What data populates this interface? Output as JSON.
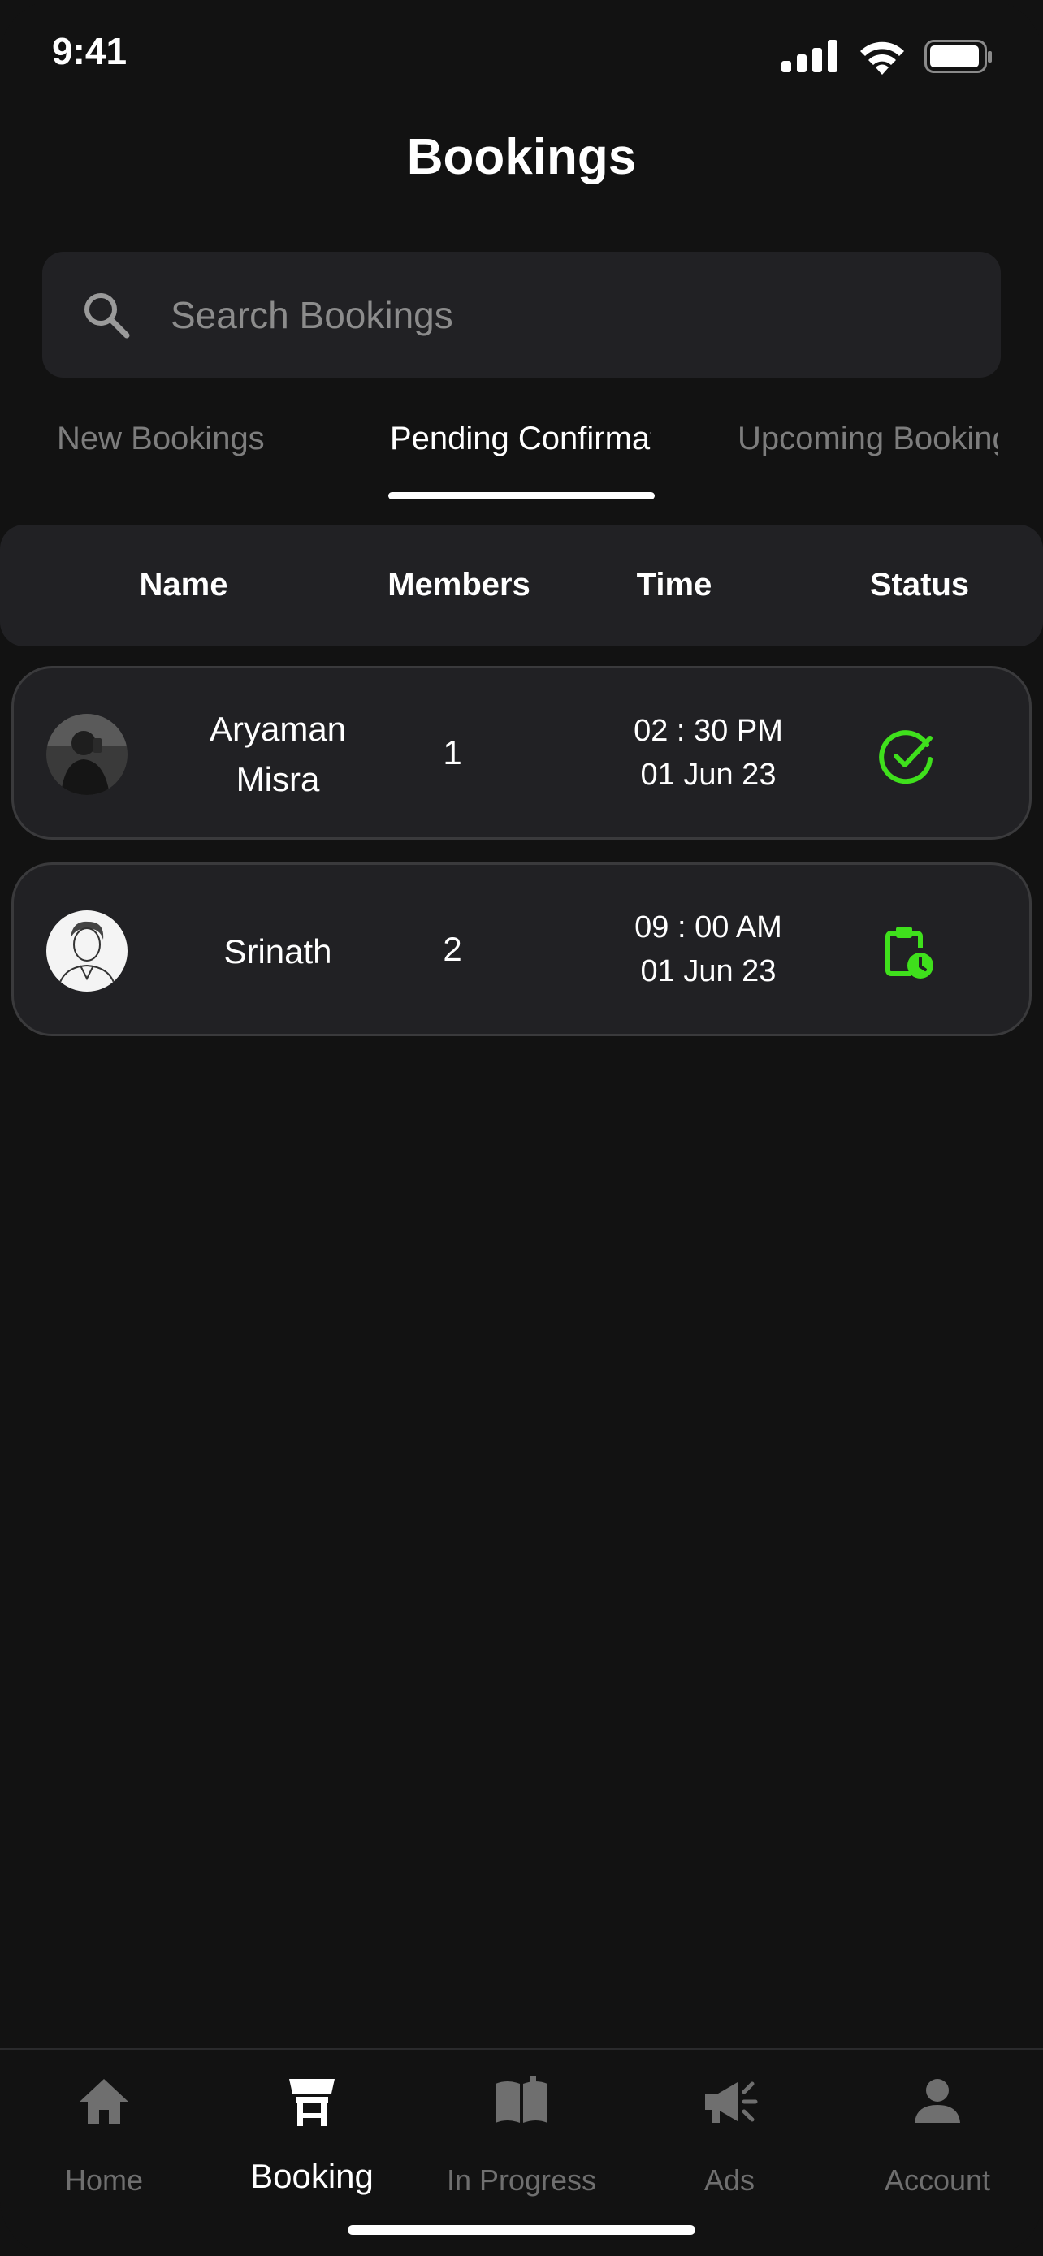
{
  "status_bar": {
    "time": "9:41"
  },
  "header": {
    "title": "Bookings"
  },
  "search": {
    "placeholder": "Search Bookings"
  },
  "tabs": [
    {
      "label": "New Bookings"
    },
    {
      "label": "Pending Confirmation"
    },
    {
      "label": "Upcoming Bookings"
    }
  ],
  "table": {
    "columns": [
      "Name",
      "Members",
      "Time",
      "Status"
    ],
    "rows": [
      {
        "name_line1": "Aryaman",
        "name_line2": "Misra",
        "members": "1",
        "time": "02 : 30  PM",
        "date": "01 Jun 23",
        "status_icon": "check-circle-icon"
      },
      {
        "name_line1": "Srinath",
        "members": "2",
        "time": "09 : 00  AM",
        "date": "01 Jun 23",
        "status_icon": "clipboard-clock-icon"
      }
    ]
  },
  "bottom_nav": [
    {
      "label": "Home",
      "icon": "home-icon"
    },
    {
      "label": "Booking",
      "icon": "table-icon"
    },
    {
      "label": "In Progress",
      "icon": "book-icon"
    },
    {
      "label": "Ads",
      "icon": "megaphone-icon"
    },
    {
      "label": "Account",
      "icon": "user-icon"
    }
  ],
  "colors": {
    "accent_green": "#3fe01c",
    "background": "#121212",
    "card": "#212124"
  }
}
